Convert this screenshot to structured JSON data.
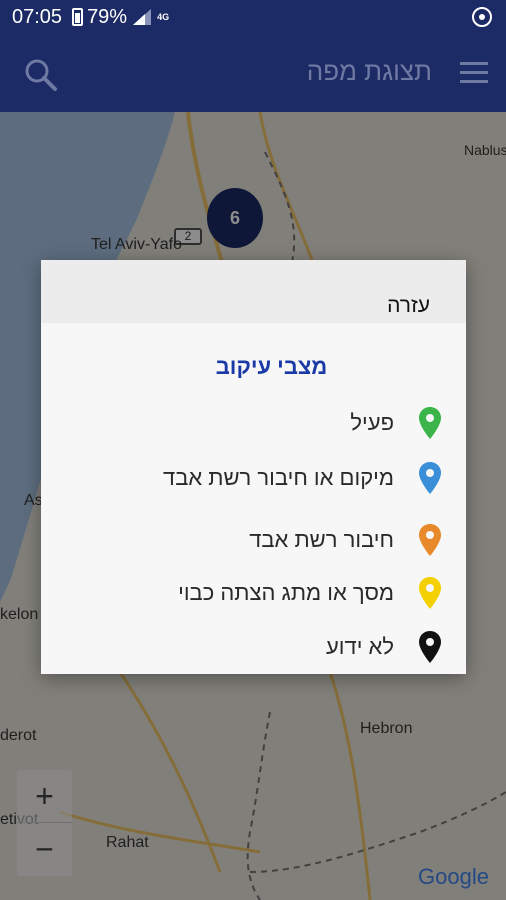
{
  "status_bar": {
    "time": "07:05",
    "battery": "79%",
    "network": "4G"
  },
  "app_bar": {
    "title": "תצוגת מפה",
    "menu_icon": "menu-icon",
    "search_icon": "search-icon"
  },
  "map": {
    "cluster_count": "6",
    "road_marker": "2",
    "labels": {
      "tel_aviv": "Tel Aviv-Yafo",
      "nablus": "Nablus",
      "hebron": "Hebron",
      "rahat": "Rahat",
      "ashdod_part": "As",
      "ashkelon_part": "kelon",
      "sderot_part": "derot",
      "netivot_part": "etivot"
    },
    "zoom_in": "+",
    "zoom_out": "−",
    "attribution": "Google"
  },
  "dialog": {
    "title": "עזרה",
    "subtitle": "מצבי עיקוב",
    "items": [
      {
        "label": "פעיל",
        "color": "#3bb54a"
      },
      {
        "label": "מיקום או חיבור רשת אבד",
        "color": "#3b8fd9"
      },
      {
        "label": "חיבור רשת אבד",
        "color": "#e8892b"
      },
      {
        "label": "מסך או מתג הצתה כבוי",
        "color": "#f5d000"
      },
      {
        "label": "לא ידוע",
        "color": "#111111"
      }
    ]
  }
}
